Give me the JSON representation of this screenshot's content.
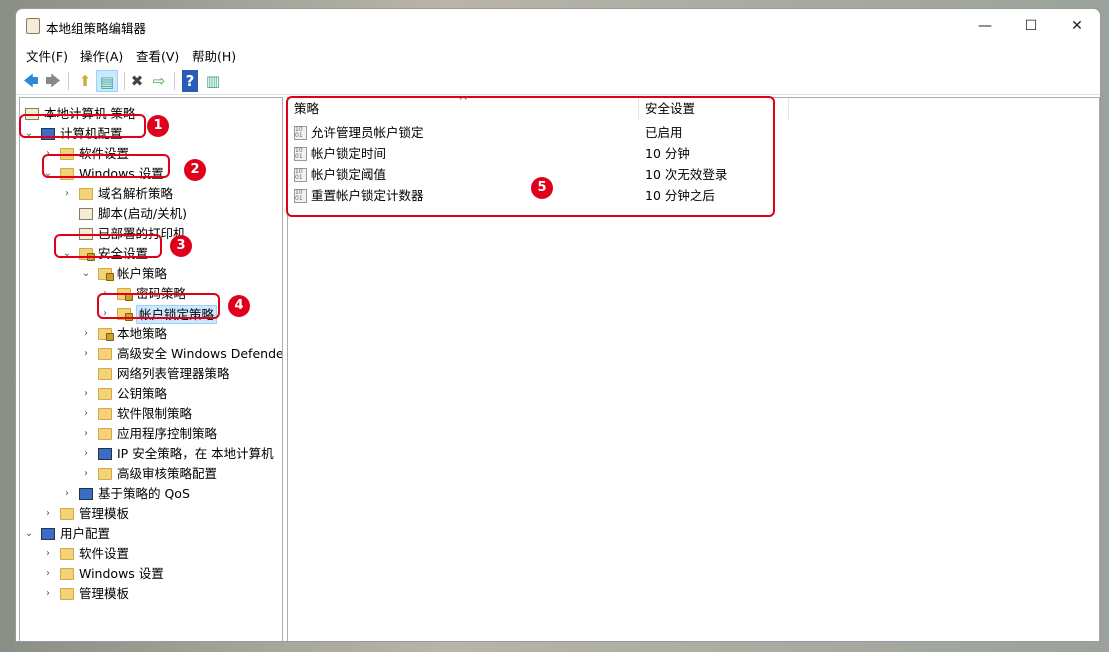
{
  "window": {
    "title": "本地组策略编辑器",
    "minimize": "—",
    "maximize": "☐",
    "close": "✕"
  },
  "menu": [
    "文件(F)",
    "操作(A)",
    "查看(V)",
    "帮助(H)"
  ],
  "toolbar": {
    "back": "🡄",
    "forward": "🡆",
    "up": "⬆",
    "show_hide": "▤",
    "delete": "✖",
    "export": "⇨",
    "help": "?",
    "properties": "▥"
  },
  "tree": [
    {
      "label": "本地计算机 策略",
      "level": 0,
      "chevron": "",
      "icon": "doc"
    },
    {
      "label": "计算机配置",
      "level": 1,
      "chevron": "⌄",
      "icon": "comp"
    },
    {
      "label": "软件设置",
      "level": 2,
      "chevron": "›",
      "icon": "folder"
    },
    {
      "label": "Windows 设置",
      "level": 2,
      "chevron": "⌄",
      "icon": "folder"
    },
    {
      "label": "域名解析策略",
      "level": 3,
      "chevron": "›",
      "icon": "folder"
    },
    {
      "label": "脚本(启动/关机)",
      "level": 3,
      "chevron": "",
      "icon": "doc"
    },
    {
      "label": "已部署的打印机",
      "level": 3,
      "chevron": "",
      "icon": "doc"
    },
    {
      "label": "安全设置",
      "level": 3,
      "chevron": "⌄",
      "icon": "lock"
    },
    {
      "label": "帐户策略",
      "level": 4,
      "chevron": "⌄",
      "icon": "lock"
    },
    {
      "label": "密码策略",
      "level": 5,
      "chevron": "›",
      "icon": "lock"
    },
    {
      "label": "帐户锁定策略",
      "level": 5,
      "chevron": "›",
      "icon": "lock",
      "selected": true
    },
    {
      "label": "本地策略",
      "level": 4,
      "chevron": "›",
      "icon": "lock"
    },
    {
      "label": "高级安全 Windows Defender",
      "level": 4,
      "chevron": "›",
      "icon": "folder"
    },
    {
      "label": "网络列表管理器策略",
      "level": 4,
      "chevron": "",
      "icon": "folder"
    },
    {
      "label": "公钥策略",
      "level": 4,
      "chevron": "›",
      "icon": "folder"
    },
    {
      "label": "软件限制策略",
      "level": 4,
      "chevron": "›",
      "icon": "folder"
    },
    {
      "label": "应用程序控制策略",
      "level": 4,
      "chevron": "›",
      "icon": "folder"
    },
    {
      "label": "IP 安全策略，在 本地计算机",
      "level": 4,
      "chevron": "›",
      "icon": "comp"
    },
    {
      "label": "高级审核策略配置",
      "level": 4,
      "chevron": "›",
      "icon": "folder"
    },
    {
      "label": "基于策略的 QoS",
      "level": 3,
      "chevron": "›",
      "icon": "comp"
    },
    {
      "label": "管理模板",
      "level": 2,
      "chevron": "›",
      "icon": "folder"
    },
    {
      "label": "用户配置",
      "level": 1,
      "chevron": "⌄",
      "icon": "comp"
    },
    {
      "label": "软件设置",
      "level": 2,
      "chevron": "›",
      "icon": "folder"
    },
    {
      "label": "Windows 设置",
      "level": 2,
      "chevron": "›",
      "icon": "folder"
    },
    {
      "label": "管理模板",
      "level": 2,
      "chevron": "›",
      "icon": "folder"
    }
  ],
  "list": {
    "columns": [
      "策略",
      "安全设置"
    ],
    "sort_indicator": "^",
    "rows": [
      {
        "policy": "允许管理员帐户锁定",
        "setting": "已启用"
      },
      {
        "policy": "帐户锁定时间",
        "setting": "10 分钟"
      },
      {
        "policy": "帐户锁定阈值",
        "setting": "10 次无效登录"
      },
      {
        "policy": "重置帐户锁定计数器",
        "setting": "10 分钟之后"
      }
    ]
  },
  "annotations": [
    "1",
    "2",
    "3",
    "4",
    "5"
  ],
  "colors": {
    "annotation": "#e0001b",
    "selection": "#cce8ff"
  }
}
